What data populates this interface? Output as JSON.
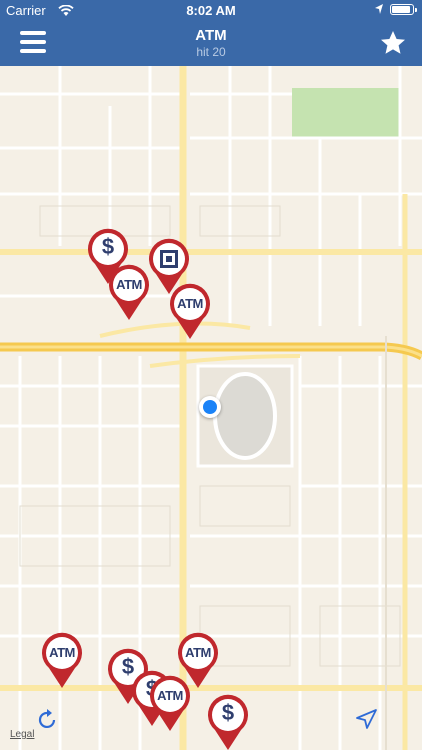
{
  "status_bar": {
    "carrier": "Carrier",
    "time": "8:02 AM"
  },
  "nav_bar": {
    "title": "ATM",
    "subtitle": "hit 20",
    "left_icon": "hamburger-menu-icon",
    "right_icon": "star-icon"
  },
  "map": {
    "legal_label": "Legal",
    "pins": [
      {
        "kind": "dollar",
        "label": "$"
      },
      {
        "kind": "square",
        "label": ""
      },
      {
        "kind": "atm",
        "label": "ATM"
      },
      {
        "kind": "atm",
        "label": "ATM"
      },
      {
        "kind": "atm",
        "label": "ATM"
      },
      {
        "kind": "atm",
        "label": "ATM"
      },
      {
        "kind": "dollar",
        "label": "$"
      },
      {
        "kind": "dollar",
        "label": "$"
      },
      {
        "kind": "atm",
        "label": "ATM"
      },
      {
        "kind": "dollar",
        "label": "$"
      }
    ],
    "bottom_left_icon": "refresh-icon",
    "bottom_right_icon": "location-arrow-icon"
  },
  "colors": {
    "nav": "#3a69a8",
    "pin": "#c0282d",
    "pin_text": "#2f3e6e",
    "user_dot": "#1a82f7"
  }
}
